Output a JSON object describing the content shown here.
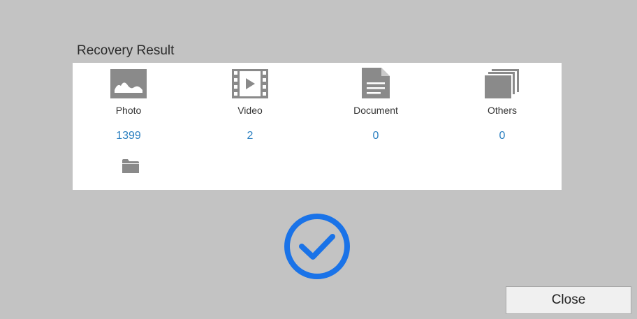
{
  "dialog": {
    "title": "Recovery Result"
  },
  "categories": [
    {
      "key": "photo",
      "label": "Photo",
      "count": "1399",
      "icon": "image-icon"
    },
    {
      "key": "video",
      "label": "Video",
      "count": "2",
      "icon": "film-icon"
    },
    {
      "key": "document",
      "label": "Document",
      "count": "0",
      "icon": "document-icon"
    },
    {
      "key": "others",
      "label": "Others",
      "count": "0",
      "icon": "stacked-files-icon"
    }
  ],
  "folder": {
    "icon": "folder-icon"
  },
  "status": {
    "icon": "checkmark-circle-icon",
    "color": "#1a73e8"
  },
  "actions": {
    "close_label": "Close"
  },
  "colors": {
    "background": "#c3c3c3",
    "panel": "#ffffff",
    "icon_gray": "#8a8a8a",
    "count_blue": "#2a7fc0",
    "check_blue": "#1a73e8"
  }
}
